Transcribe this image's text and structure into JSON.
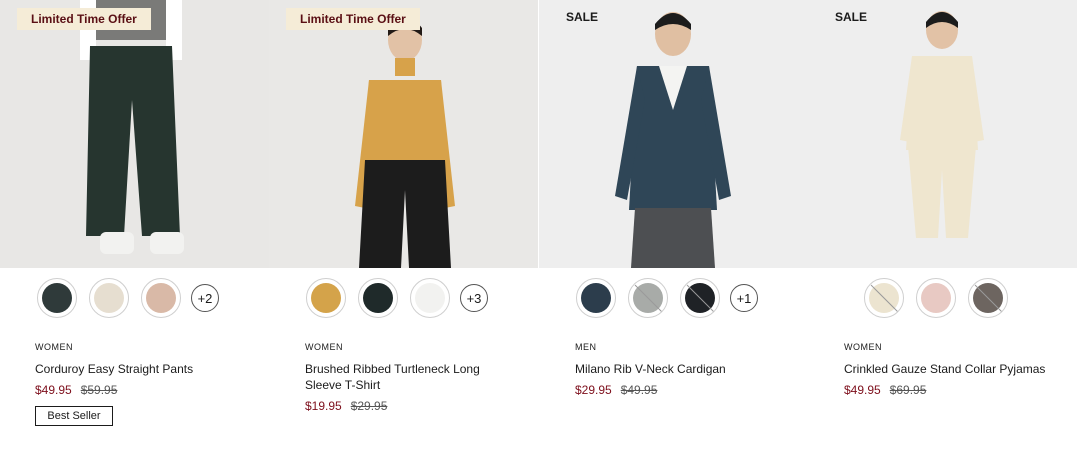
{
  "products": [
    {
      "badge": "Limited Time Offer",
      "more_colors": "+2",
      "gender": "WOMEN",
      "name": "Corduroy Easy Straight Pants",
      "price": "$49.95",
      "original_price": "$59.95",
      "tag": "Best Seller",
      "swatch_colors": [
        "#2f3a3a",
        "#e6ded0",
        "#d9b9a7"
      ],
      "image_colors": {
        "background": "#e8e7e5",
        "garment": "#26352f"
      }
    },
    {
      "badge": "Limited Time Offer",
      "more_colors": "+3",
      "gender": "WOMEN",
      "name": "Brushed Ribbed Turtleneck Long Sleeve T-Shirt",
      "price": "$19.95",
      "original_price": "$29.95",
      "swatch_colors": [
        "#d4a34a",
        "#1f2a2a",
        "#f2f2f0"
      ],
      "image_colors": {
        "background": "#e9e8e6",
        "garment": "#d7a24a"
      }
    },
    {
      "badge": "SALE",
      "more_colors": "+1",
      "gender": "MEN",
      "name": "Milano Rib V-Neck Cardigan",
      "price": "$29.95",
      "original_price": "$49.95",
      "swatch_colors": [
        "#2c3d4c",
        "#a8aba8",
        "#1f2226"
      ],
      "swatch_unavailable": [
        false,
        true,
        true
      ],
      "image_colors": {
        "background": "#eeeeee",
        "garment": "#2f4657"
      }
    },
    {
      "badge": "SALE",
      "gender": "WOMEN",
      "name": "Crinkled Gauze Stand Collar Pyjamas",
      "price": "$49.95",
      "original_price": "$69.95",
      "swatch_colors": [
        "#ece4d0",
        "#e8c9c3",
        "#6d6560"
      ],
      "swatch_unavailable": [
        true,
        false,
        true
      ],
      "image_colors": {
        "background": "#eeeeee",
        "garment": "#efe6cf"
      }
    }
  ],
  "colors": {
    "sale_price": "#7d0e1b",
    "badge_background": "#f5ecd7",
    "badge_text": "#5a0f14"
  }
}
